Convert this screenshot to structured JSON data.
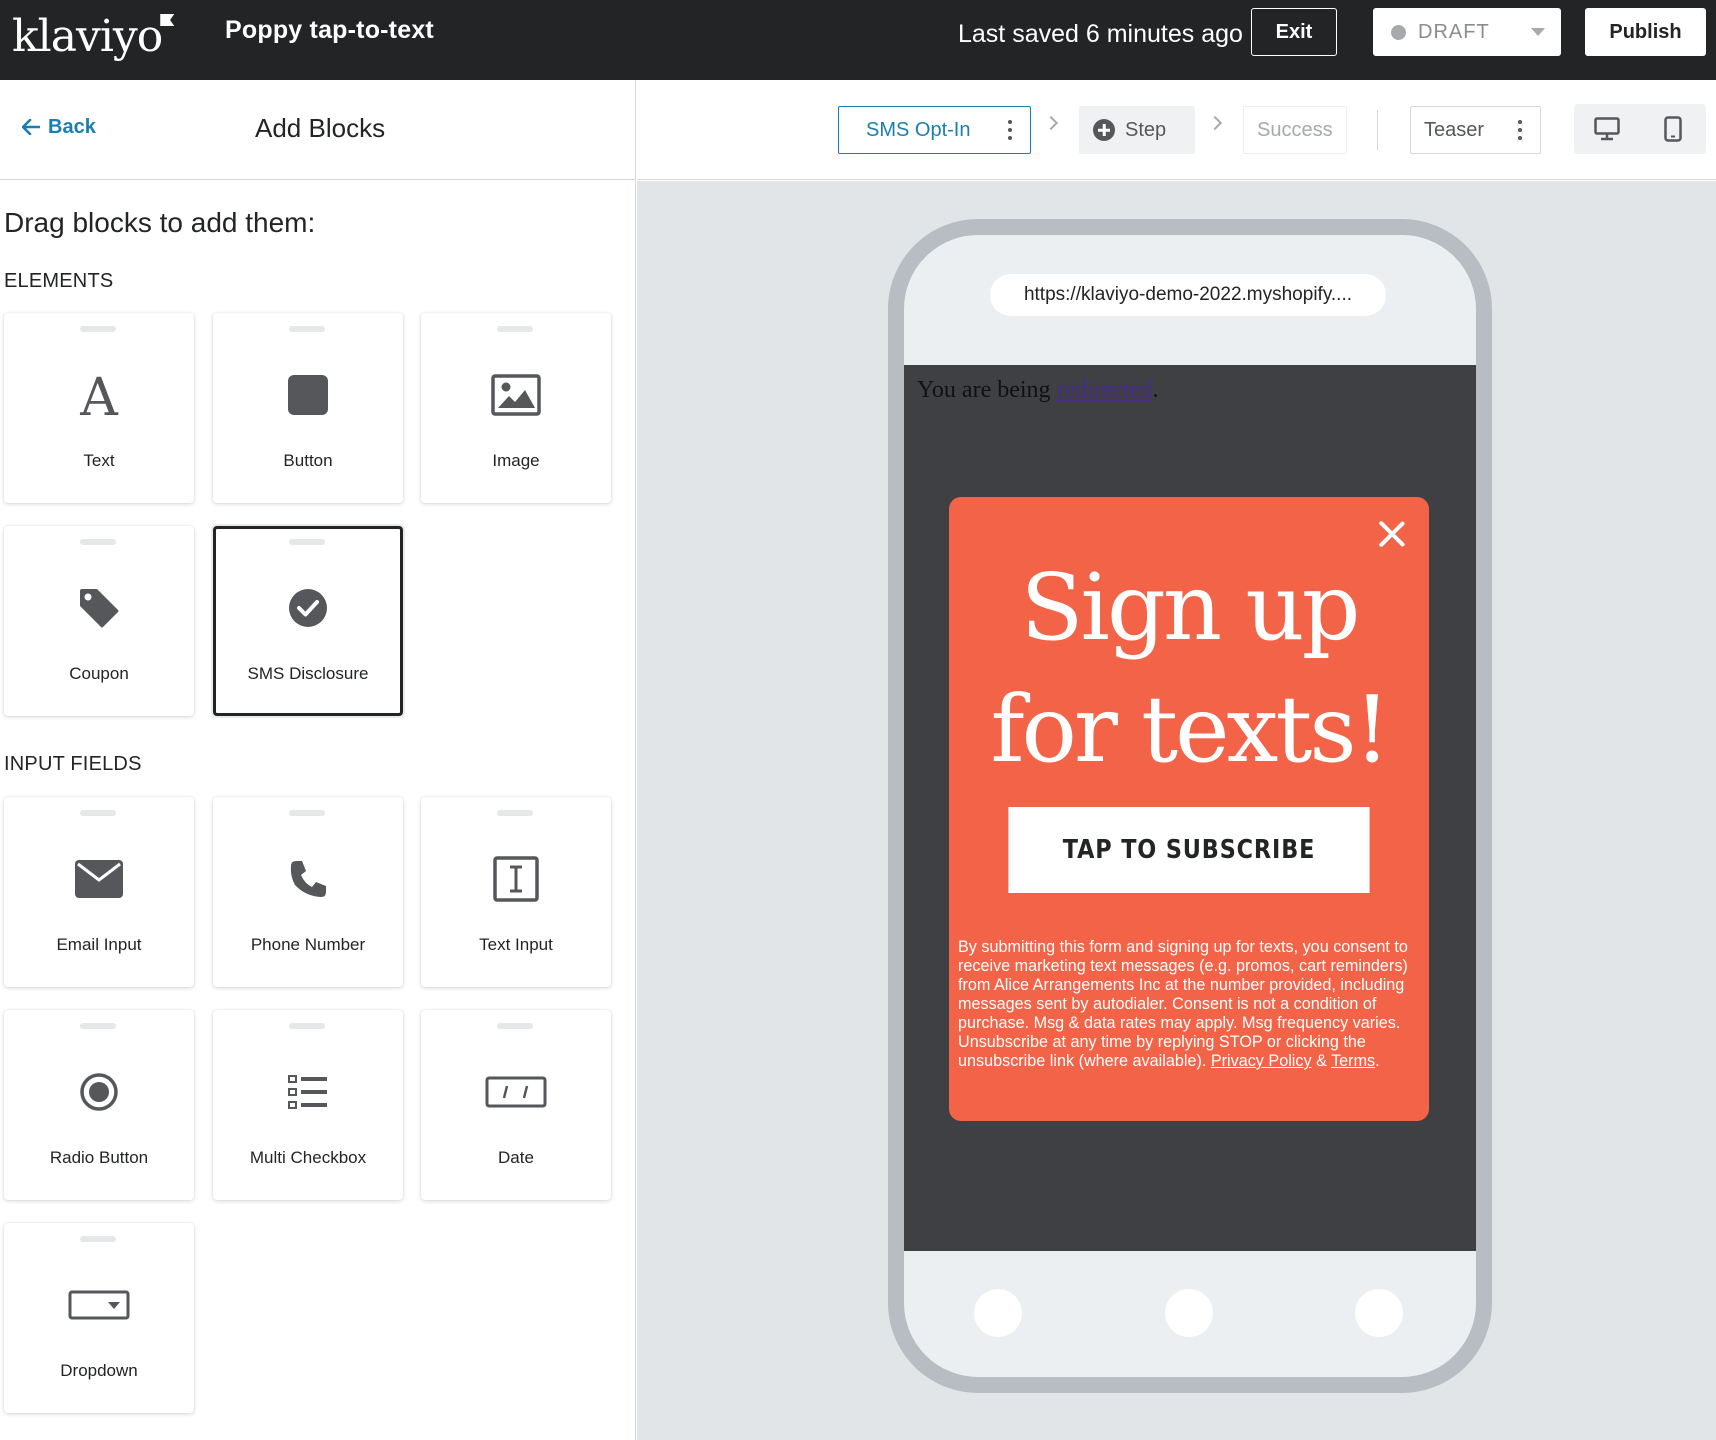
{
  "topbar": {
    "logo": "klaviyo",
    "form_name": "Poppy tap-to-text",
    "last_saved": "Last saved 6 minutes ago",
    "exit_label": "Exit",
    "status_value": "DRAFT",
    "publish_label": "Publish"
  },
  "left_panel": {
    "back_label": "Back",
    "title": "Add Blocks",
    "drag_title": "Drag blocks to add them:",
    "elements_heading": "ELEMENTS",
    "elements": [
      {
        "label": "Text",
        "icon": "text-icon"
      },
      {
        "label": "Button",
        "icon": "button-icon"
      },
      {
        "label": "Image",
        "icon": "image-icon"
      },
      {
        "label": "Coupon",
        "icon": "coupon-tag-icon"
      },
      {
        "label": "SMS Disclosure",
        "icon": "check-circle-icon",
        "selected": true
      }
    ],
    "input_heading": "INPUT FIELDS",
    "inputs": [
      {
        "label": "Email Input",
        "icon": "envelope-icon"
      },
      {
        "label": "Phone Number",
        "icon": "phone-icon"
      },
      {
        "label": "Text Input",
        "icon": "text-cursor-icon"
      },
      {
        "label": "Radio Button",
        "icon": "radio-icon"
      },
      {
        "label": "Multi Checkbox",
        "icon": "checklist-icon"
      },
      {
        "label": "Date",
        "icon": "date-icon"
      },
      {
        "label": "Dropdown",
        "icon": "dropdown-icon"
      }
    ]
  },
  "steps": {
    "opt_in": "SMS Opt-In",
    "add_step": "Step",
    "success": "Success",
    "teaser": "Teaser"
  },
  "preview": {
    "url": "https://klaviyo-demo-2022.myshopify....",
    "redirect_prefix": "You are being ",
    "redirect_link": "redirected",
    "redirect_suffix": ".",
    "headline_line1": "Sign up",
    "headline_line2": "for texts!",
    "subscribe_label": "TAP TO SUBSCRIBE",
    "disclosure_text": "By submitting this form and signing up for texts, you consent to receive marketing text messages (e.g. promos, cart reminders) from Alice Arrangements Inc at the number provided, including messages sent by autodialer. Consent is not a condition of purchase. Msg & data rates may apply. Msg frequency varies. Unsubscribe at any time by replying STOP or clicking the unsubscribe link (where available). ",
    "privacy_link": "Privacy Policy",
    "amp": " & ",
    "terms_link": "Terms",
    "terms_end": "."
  },
  "colors": {
    "topbar_bg": "#232426",
    "accent_link": "#1a7fb0",
    "popup_bg": "#f26347",
    "phone_frame": "#b8bdc3",
    "canvas_bg": "#e1e5e8"
  }
}
